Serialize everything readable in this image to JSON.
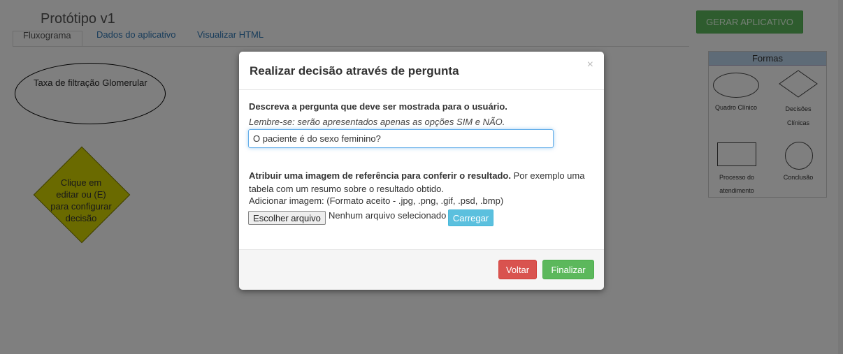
{
  "app": {
    "title": "Protótipo v1",
    "generate_label": "GERAR APLICATIVO"
  },
  "tabs": [
    "Fluxograma",
    "Dados do aplicativo",
    "Visualizar HTML"
  ],
  "canvas": {
    "ellipse_text": "Taxa de filtração Glomerular",
    "diamond_text": [
      "Clique em",
      "editar ou (E)",
      "para configurar",
      "decisão"
    ]
  },
  "shapes": {
    "header": "Formas",
    "items": [
      "Quadro Clínico",
      "Decisões",
      "Clínicas",
      "Processo do",
      "atendimento",
      "Conclusão"
    ]
  },
  "modal": {
    "title": "Realizar decisão através de pergunta",
    "close": "×",
    "question_label": "Descreva a pergunta que deve ser mostrada para o usuário.",
    "question_hint": "Lembre-se: serão apresentados apenas as opções SIM e NÃO.",
    "question_value": "O paciente é do sexo feminino?",
    "image_label_bold": "Atribuir uma imagem de referência para conferir o resultado.",
    "image_label_rest": " Por exemplo uma tabela com um resumo sobre o resultado obtido.",
    "image_formats": "Adicionar imagem: (Formato aceito - .jpg, .png, .gif, .psd, .bmp)",
    "file_button": "Escolher arquivo",
    "file_none": "Nenhum arquivo selecionado",
    "upload_button": "Carregar",
    "back_button": "Voltar",
    "finish_button": "Finalizar"
  }
}
